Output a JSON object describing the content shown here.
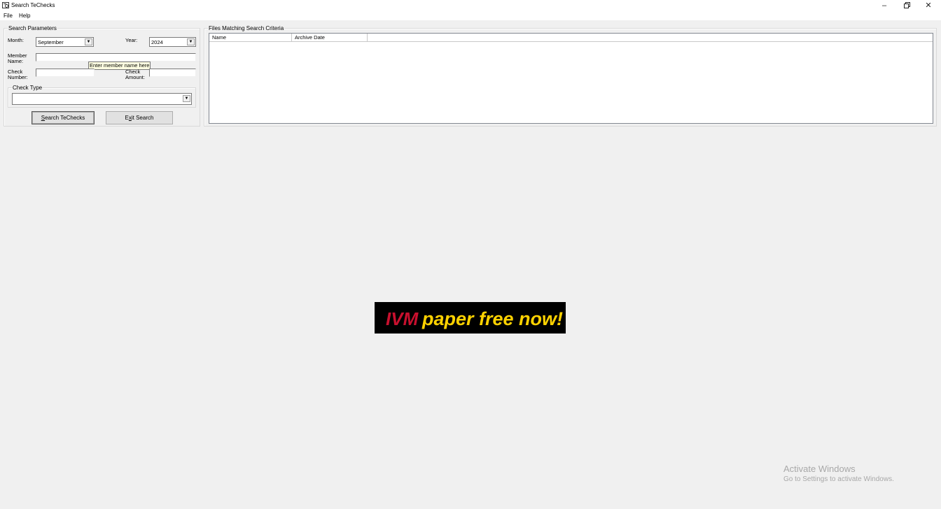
{
  "window": {
    "title": "Search TeChecks"
  },
  "menu": {
    "items": [
      "File",
      "Help"
    ]
  },
  "search_params": {
    "group_label": "Search Parameters",
    "month_label": "Month:",
    "month_value": "September",
    "year_label": "Year:",
    "year_value": "2024",
    "member_label_line1": "Member",
    "member_label_line2": "Name:",
    "member_value": "",
    "tooltip": "Enter member name here",
    "check_number_label_line1": "Check",
    "check_number_label_line2": "Number:",
    "check_number_value": "",
    "check_amount_label_line1": "Check",
    "check_amount_label_line2": "Amount:",
    "check_amount_value": "",
    "check_type_group_label": "Check Type",
    "check_type_value": "",
    "search_button_prefix": "",
    "search_button_mnemonic": "S",
    "search_button_suffix": "earch TeChecks",
    "exit_button_prefix": "E",
    "exit_button_mnemonic": "x",
    "exit_button_suffix": "it Search"
  },
  "results": {
    "group_label": "Files Matching Search Criteria",
    "columns": [
      "Name",
      "Archive Date"
    ]
  },
  "banner": {
    "brand": "IVM",
    "tagline": "paper free now!"
  },
  "watermark": {
    "title": "Activate Windows",
    "subtitle": "Go to Settings to activate Windows."
  },
  "colors": {
    "banner_brand": "#c8102e",
    "banner_tagline": "#ffd200",
    "tooltip_bg": "#ffffe1"
  }
}
